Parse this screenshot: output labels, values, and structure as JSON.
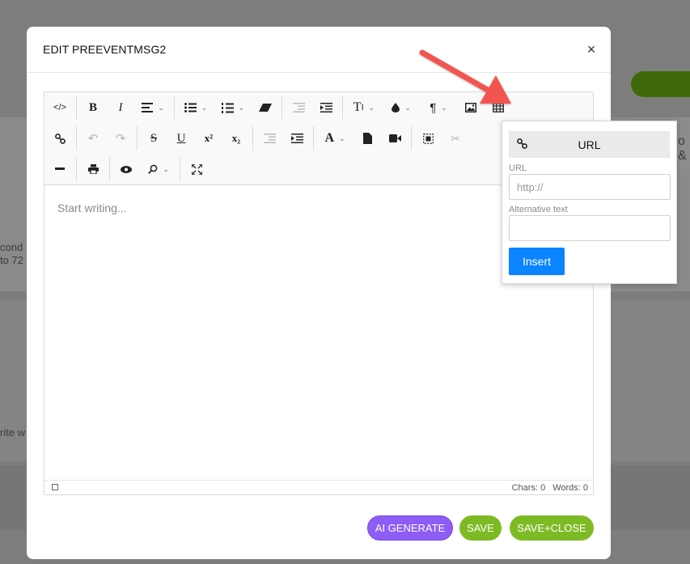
{
  "modal": {
    "title": "EDIT PREEVENTMSG2",
    "close_label": "×"
  },
  "background": {
    "fragments": [
      "cond",
      "to 72",
      "rite w",
      "o &"
    ]
  },
  "toolbar": {
    "row1": [
      "source-code",
      "bold",
      "italic",
      "align",
      "unordered-list",
      "ordered-list",
      "eraser",
      "outdent",
      "indent",
      "font-size",
      "brush",
      "paragraph",
      "image",
      "table"
    ],
    "row2": [
      "link",
      "undo",
      "redo",
      "strikethrough",
      "underline",
      "superscript",
      "subscript",
      "outdent",
      "indent",
      "font-color",
      "file",
      "video",
      "select-all",
      "cut"
    ],
    "row3": [
      "hr",
      "print",
      "preview",
      "find",
      "fullscreen"
    ],
    "glyphs": {
      "source": "</>",
      "bold": "B",
      "italic": "I",
      "underline": "U",
      "strike": "S",
      "superscript": "x²",
      "subscript": "x₂",
      "font": "A",
      "font_size": "T",
      "paragraph": "¶"
    }
  },
  "editor": {
    "placeholder": "Start writing...",
    "chars": "Chars: 0",
    "words": "Words: 0"
  },
  "image_popup": {
    "tab_label": "URL",
    "url_label": "URL",
    "url_placeholder": "http://",
    "alt_label": "Alternative text",
    "alt_value": "",
    "insert_label": "Insert"
  },
  "footer": {
    "ai_generate": "AI GENERATE",
    "save": "SAVE",
    "save_close": "SAVE+CLOSE"
  },
  "colors": {
    "ai_button": "#8f5cf6",
    "save_button": "#7dbb24",
    "insert_button": "#0a84ff",
    "arrow": "#f25450"
  }
}
